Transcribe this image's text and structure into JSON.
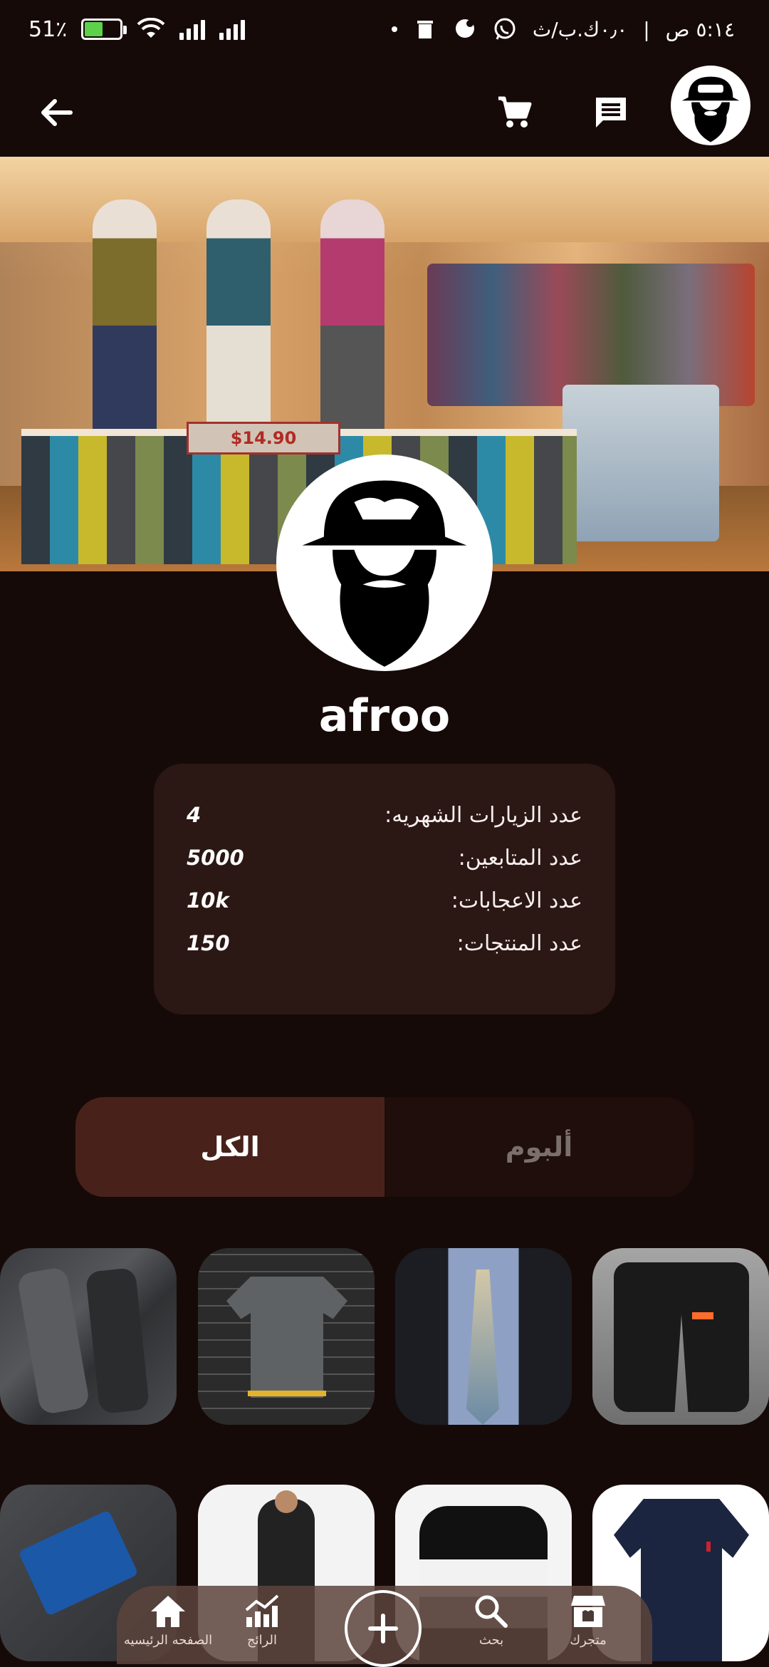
{
  "status_bar": {
    "time": "٥:١٤ ص",
    "data_speed": "٠٫٠ك.ب/ث",
    "separator": "|",
    "battery_percent": "51٪",
    "battery_level": 0.51,
    "icons": [
      "dot-icon",
      "delete-icon",
      "messenger-icon",
      "whatsapp-icon",
      "battery-charging-icon",
      "wifi-icon",
      "signal-icon"
    ]
  },
  "header": {
    "icons": [
      "back-arrow-icon",
      "cart-icon",
      "chat-icon",
      "store-avatar"
    ]
  },
  "profile": {
    "username": "afroo",
    "stats": [
      {
        "label": "عدد الزيارات الشهريه:",
        "value": "4"
      },
      {
        "label": "عدد المتابعين:",
        "value": "5000"
      },
      {
        "label": "عدد الاعجابات:",
        "value": "10k"
      },
      {
        "label": "عدد المنتجات:",
        "value": "150"
      }
    ]
  },
  "cover": {
    "sign_text": "$14.90"
  },
  "tabs": {
    "all": "الكل",
    "album": "ألبوم",
    "selected": "الكل"
  },
  "products": [
    {
      "name": "grey-pants"
    },
    {
      "name": "grey-tshirt"
    },
    {
      "name": "suit-tie"
    },
    {
      "name": "black-cargo-pants"
    },
    {
      "name": "pocket-square"
    },
    {
      "name": "black-shirt"
    },
    {
      "name": "black-white-hoodie"
    },
    {
      "name": "navy-polo"
    }
  ],
  "bottom_nav": {
    "home": "الصفحه الرئيسيه",
    "trending": "الرائج",
    "add": "",
    "search": "بحث",
    "store": "متجرك"
  }
}
